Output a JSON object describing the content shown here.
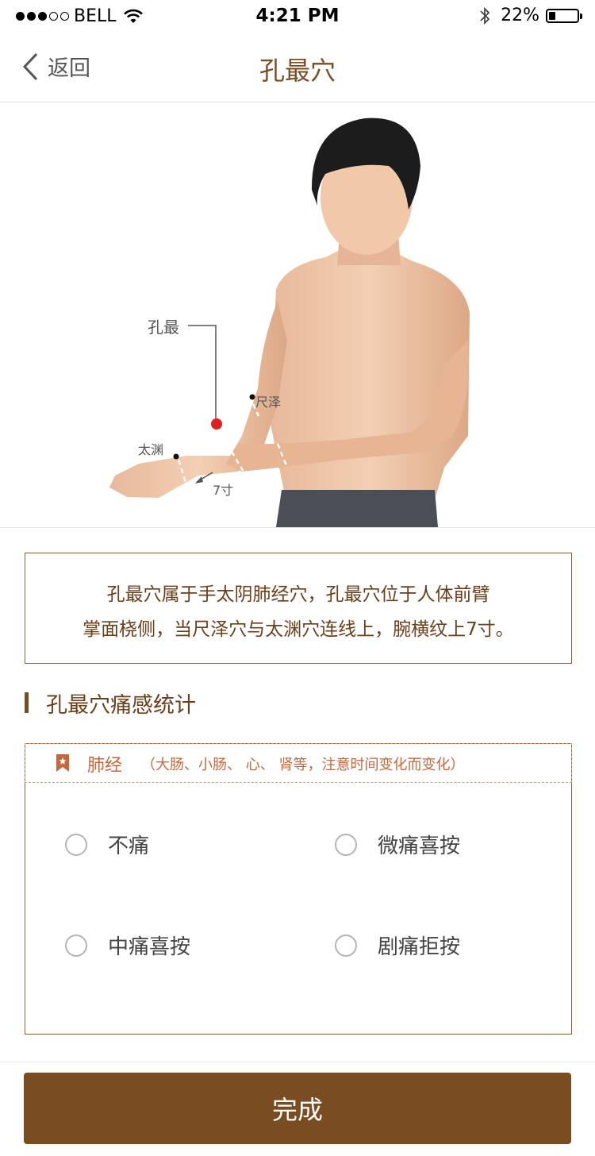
{
  "status_bar": {
    "carrier": "BELL",
    "time": "4:21 PM",
    "battery": "22%"
  },
  "nav": {
    "back_label": "返回",
    "title": "孔最穴"
  },
  "figure": {
    "labels": {
      "kongzui": "孔最",
      "chize": "尺泽",
      "taiyuan": "太渊",
      "distance": "7寸"
    }
  },
  "description": {
    "line1": "孔最穴属于手太阴肺经穴，孔最穴位于人体前臂",
    "line2": "掌面桡侧，当尺泽穴与太渊穴连线上，腕横纹上7寸。"
  },
  "section": {
    "title": "孔最穴痛感统计"
  },
  "card": {
    "meridian": "肺经",
    "note": "（大肠、小肠、 心、 肾等，注意时间变化而变化）",
    "options": [
      "不痛",
      "微痛喜按",
      "中痛喜按",
      "剧痛拒按"
    ]
  },
  "footer": {
    "done_label": "完成"
  },
  "colors": {
    "brand": "#7a4c22",
    "accent": "#c6673e",
    "point": "#e02020"
  }
}
